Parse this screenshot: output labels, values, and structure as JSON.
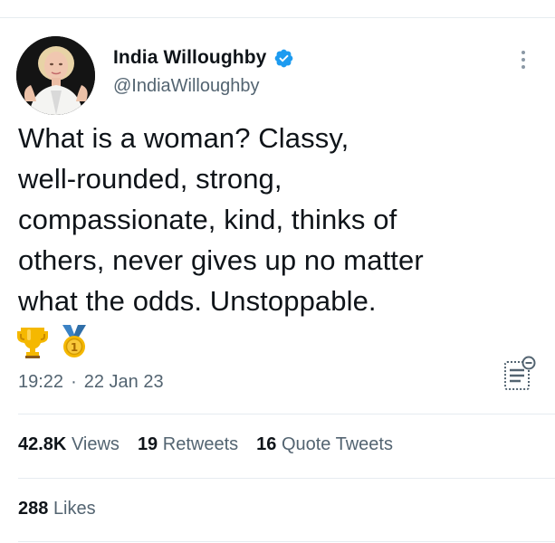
{
  "tweet": {
    "author": {
      "display_name": "India Willoughby",
      "handle": "@IndiaWilloughby",
      "avatar_icon": "profile-photo",
      "verified_icon": "verified-badge-icon",
      "verified_color": "#1d9bf0"
    },
    "text": "What is a woman? Classy,\nwell-rounded, strong,\ncompassionate, kind, thinks of\nothers, never gives up no matter\nwhat the odds. Unstoppable.",
    "emojis": [
      "trophy-icon",
      "first-place-medal-icon"
    ],
    "time": "19:22",
    "separator": "·",
    "date": "22 Jan 23",
    "notes_icon": "tweet-notes-icon"
  },
  "stats": {
    "views_count": "42.8K",
    "views_label": "Views",
    "retweets_count": "19",
    "retweets_label": "Retweets",
    "quote_tweets_count": "16",
    "quote_tweets_label": "Quote Tweets",
    "likes_count": "288",
    "likes_label": "Likes"
  },
  "colors": {
    "text_primary": "#0f1419",
    "text_secondary": "#536471",
    "divider": "#e6ecf0",
    "accent": "#1d9bf0"
  }
}
